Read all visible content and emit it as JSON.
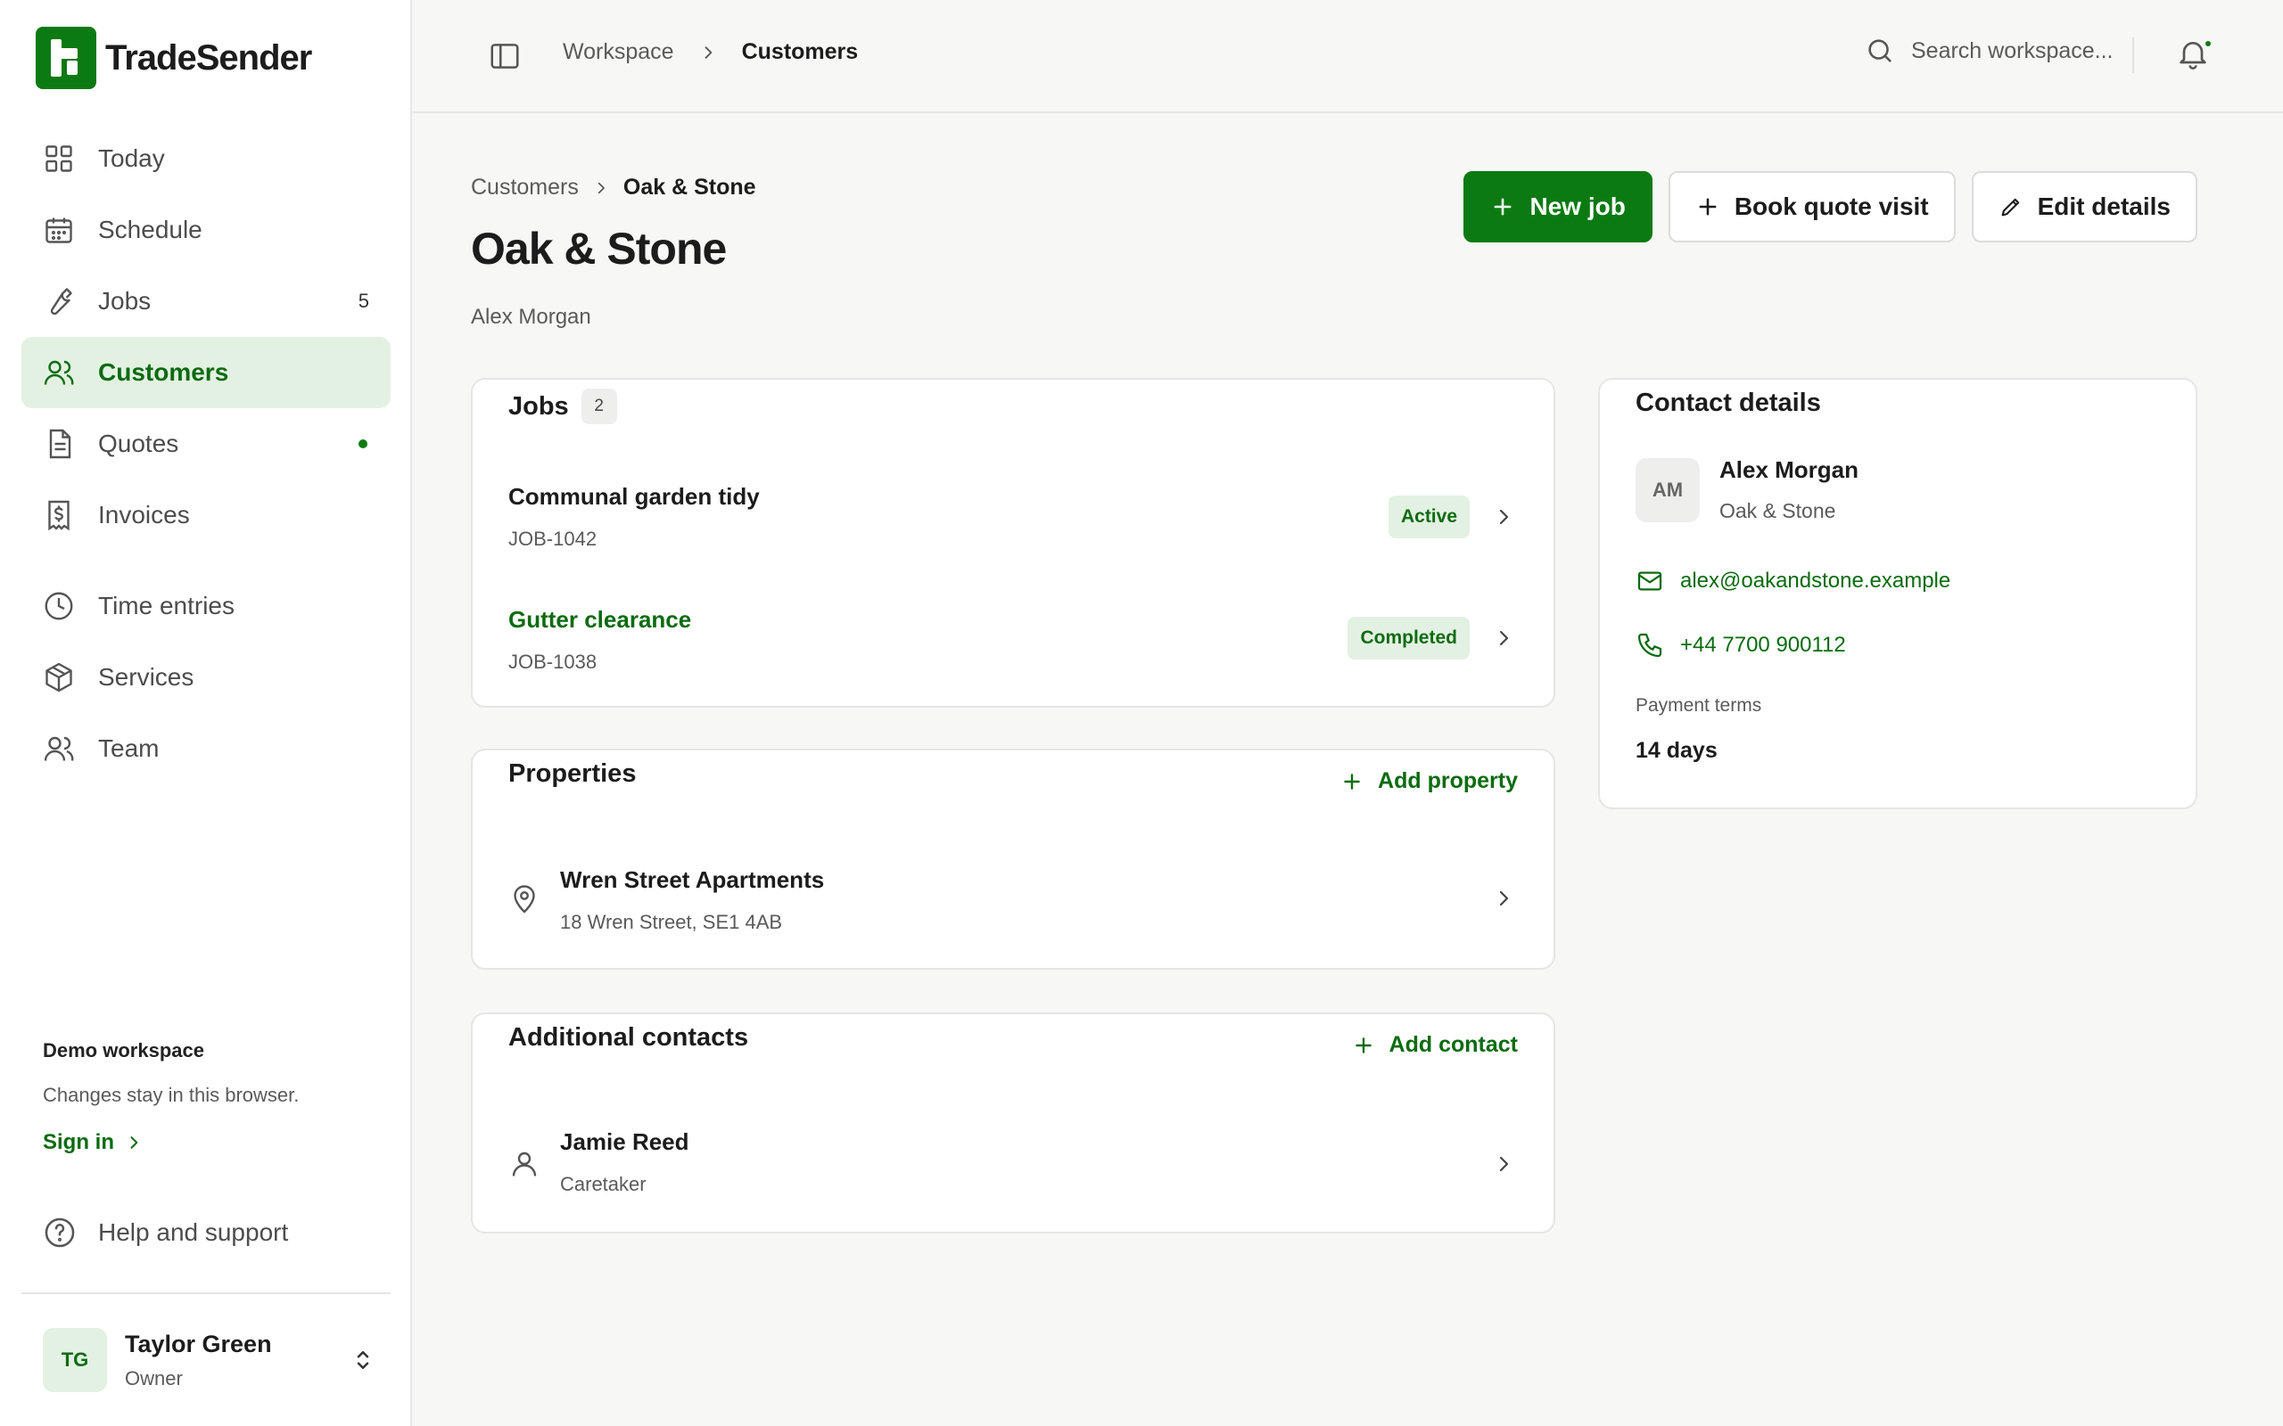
{
  "app": {
    "name": "TradeSender"
  },
  "sidebar": {
    "items": [
      {
        "label": "Today",
        "icon": "grid-icon"
      },
      {
        "label": "Schedule",
        "icon": "calendar-icon"
      },
      {
        "label": "Jobs",
        "icon": "wrench-icon",
        "count": "5"
      },
      {
        "label": "Customers",
        "icon": "users-icon",
        "active": true
      },
      {
        "label": "Quotes",
        "icon": "document-icon",
        "dot": true
      },
      {
        "label": "Invoices",
        "icon": "receipt-icon"
      },
      {
        "label": "Time entries",
        "icon": "clock-icon"
      },
      {
        "label": "Services",
        "icon": "package-icon"
      },
      {
        "label": "Team",
        "icon": "team-icon"
      }
    ],
    "demo": {
      "title": "Demo workspace",
      "text": "Changes stay in this browser.",
      "signin": "Sign in"
    },
    "help": "Help and support",
    "user": {
      "initials": "TG",
      "name": "Taylor Green",
      "role": "Owner"
    }
  },
  "topbar": {
    "breadcrumbs": [
      "Workspace",
      "Customers"
    ],
    "search_placeholder": "Search workspace..."
  },
  "page": {
    "breadcrumbs": [
      "Customers",
      "Oak & Stone"
    ],
    "title": "Oak & Stone",
    "subtitle": "Alex Morgan",
    "actions": {
      "new_job": "New job",
      "book_quote": "Book quote visit",
      "edit": "Edit details"
    }
  },
  "jobs": {
    "title": "Jobs",
    "count": "2",
    "items": [
      {
        "title": "Communal garden tidy",
        "id": "JOB-1042",
        "status": "Active"
      },
      {
        "title": "Gutter clearance",
        "id": "JOB-1038",
        "status": "Completed"
      }
    ]
  },
  "properties": {
    "title": "Properties",
    "add_label": "Add property",
    "items": [
      {
        "name": "Wren Street Apartments",
        "address": "18 Wren Street, SE1 4AB"
      }
    ]
  },
  "contacts": {
    "title": "Additional contacts",
    "add_label": "Add contact",
    "items": [
      {
        "name": "Jamie Reed",
        "role": "Caretaker"
      }
    ]
  },
  "contact_details": {
    "title": "Contact details",
    "initials": "AM",
    "name": "Alex Morgan",
    "company": "Oak & Stone",
    "email": "alex@oakandstone.example",
    "phone": "+44 7700 900112",
    "payment_label": "Payment terms",
    "payment_value": "14 days"
  },
  "colors": {
    "brand": "#0c7a12",
    "brand_light": "#e3f1e2",
    "background": "#f7f7f6"
  }
}
